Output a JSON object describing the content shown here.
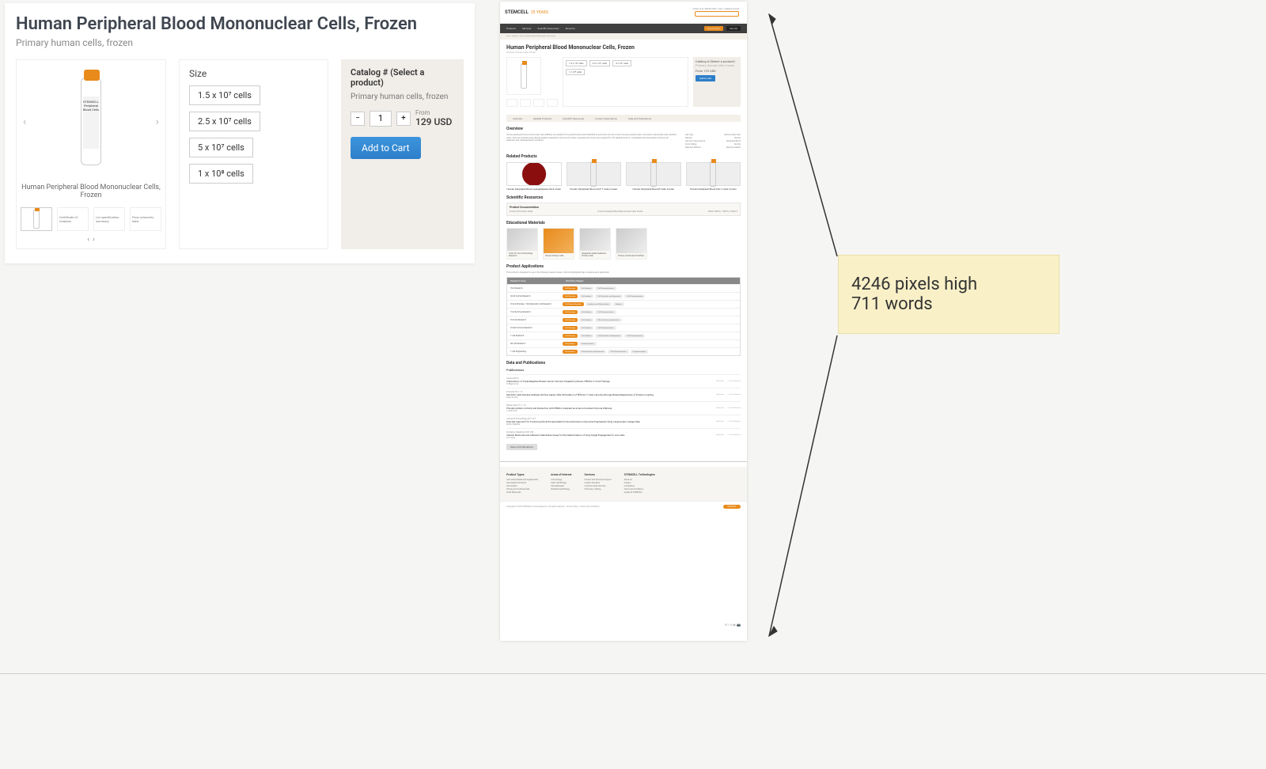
{
  "detail": {
    "title": "Human Peripheral Blood Mononuclear Cells, Frozen",
    "subtitle": "Primary human cells, frozen",
    "caption": "Human Peripheral Blood Mononuclear Cells, Frozen",
    "vial_brand": "STEMCELL",
    "vial_line1": "Peripheral",
    "vial_line2": "Blood Cells",
    "sizes": [
      "1.5 x 10⁷ cells",
      "2.5 x 10⁷ cells",
      "5 x 10⁷ cells",
      "1 x 10⁸ cells"
    ],
    "size_label": "Size",
    "catalog_label": "Catalog # (Select a product)",
    "qty": "1",
    "price_from": "From",
    "price": "129 USD",
    "add_to_cart": "Add to Cart"
  },
  "annotation": {
    "line1": "4246 pixels high",
    "line2": "711 words"
  },
  "fullpage": {
    "logo_main": "STEMCELL",
    "logo_years": "25 YEARS",
    "top_links": "Contact us at 1 800 667 0322 • Log in • Create an account",
    "search_placeholder": "Search for a product or resource",
    "nav": [
      "Products",
      "Services",
      "Scientific Resources",
      "About Us"
    ],
    "nav_right": [
      "Quick Order",
      "Cart (0)"
    ],
    "breadcrumb": "Home › Products › Human Peripheral Blood Mononuclear Cells, Frozen",
    "title": "Human Peripheral Blood Mononuclear Cells, Frozen",
    "subtitle": "Primary human cells, frozen",
    "sizes": [
      "1.5 x 10⁷ cells",
      "2.5 x 10⁷ cells",
      "5 x 10⁷ cells",
      "1 x 10⁸ cells"
    ],
    "catalog": "Catalog # (Select a product)",
    "cart_sub": "Primary human cells, frozen",
    "price": "From 129 USD",
    "add": "Add to Cart",
    "tabs": [
      "Overview",
      "Related Products",
      "Scientific Resources",
      "Product Applications",
      "Data and Publications"
    ],
    "overview_h": "Overview",
    "overview_txt": "Human peripheral blood mononuclear cells (PBMCs) are isolated from peripheral blood and identified as any blood cell with a round nucleus (lymphocytes, monocytes, natural killer cells, dendritic cells). Cells are collected using density gradient separation protocols and viably cryopreserved. Donors are screened for HIV, hepatitis B and C. Compatible with downstream immune cell expansion and characterization workflows.",
    "overview_meta": [
      [
        "Cell Type",
        "Mononuclear Cells"
      ],
      [
        "Species",
        "Human"
      ],
      [
        "Cell and Tissue Source",
        "Peripheral Blood"
      ],
      [
        "Donor Status",
        "Normal"
      ],
      [
        "Selection Method",
        "Density Gradient"
      ]
    ],
    "related_h": "Related Products",
    "related": [
      "Human Peripheral Blood Leukapheresis Pack, Fresh",
      "Human Peripheral Blood CD4⁺ T Cells, Frozen",
      "Human Peripheral Blood B Cells, Frozen",
      "Human Peripheral Blood Pan-T Cells, Frozen"
    ],
    "sci_h": "Scientific Resources",
    "doc_h": "Product Documentation",
    "doc_row_left": "Product Information Sheet",
    "doc_row_mid": "Human Peripheral Blood Mononuclear Cells, Frozen",
    "doc_row_right": "70025, 70025.1, 70025.2, 70025.3",
    "edu_h": "Educational Materials",
    "edu_tiles": [
      "Tools for Your Immunology Research",
      "Human Primary Cells",
      "Frequently Asked Questions: Primary Cells",
      "Primary Cell Product Portfolio"
    ],
    "apps_h": "Product Applications",
    "apps_intro": "This product is designed for use in the following research areas. Click the highlighted tags to explore each application.",
    "apps_cols": [
      "Research Area",
      "Workflow Stages"
    ],
    "apps_rows": [
      {
        "area": "HLA Research",
        "tags": [
          "Cell Sourcing",
          "Cell Isolation",
          "Cell Characterization"
        ]
      },
      {
        "area": "Small Animal Research",
        "tags": [
          "Cell Sourcing",
          "Cell Isolation",
          "Cell Activation and Expansion",
          "Cell Characterization"
        ]
      },
      {
        "area": "Immunotherapy / Hematopoietic Cell Research",
        "tags": [
          "Cell Sample Donation",
          "Isolation and Differentiation",
          "Analysis"
        ]
      },
      {
        "area": "Toxicity/Drug Research",
        "tags": [
          "Cell Sourcing",
          "Cell Isolation",
          "Cell Characterization"
        ]
      },
      {
        "area": "Immune Research",
        "tags": [
          "Cell Sourcing",
          "Cell Isolation",
          "HPs and Immunostimulants"
        ]
      },
      {
        "area": "Innate Immune Research",
        "tags": [
          "Cell Sourcing",
          "Cell Isolation",
          "Cell Characterization"
        ]
      },
      {
        "area": "T Cell Research",
        "tags": [
          "Cell Sourcing",
          "Cell Isolation",
          "Cell Activation and Expansion",
          "Cell Characterization"
        ]
      },
      {
        "area": "NK Cell Research",
        "tags": [
          "Cell Isolation",
          "Characterization"
        ]
      },
      {
        "area": "T Cell Engineering",
        "tags": [
          "Cell Isolation",
          "Cell Activation and Expansion",
          "Cell Characterization",
          "Cryopreservation"
        ]
      }
    ],
    "pubs_h": "Data and Publications",
    "pubs_sub": "Publications",
    "pubs": [
      {
        "src": "Lancet (2019)",
        "title": "Implications of Triple-Negative Breast Cancer Immune-Targeted Cytotoxic PBMCs in T-Cell Therapy",
        "by": "R. Meyer et al."
      },
      {
        "src": "Immunity 30:1–12",
        "title": "Dendritic Cells Express Multiple Surface Genes After Stimulation of Effector T Cells Carrying Strongly Biased Repertoires of Protein-Coupling",
        "by": "Davis B. et al."
      },
      {
        "src": "Nature (April 11) 1–19",
        "title": "Phosphorylation Activity and Interaction with PBMCs Analyzed as a De-Convoluted Immune Pathway",
        "by": "J. Park et al."
      },
      {
        "src": "Journal of Immunology 297:1197",
        "title": "Directed Approach for Producing Novel Encapsulated Immune-Derived Compounds Engineered Using Large-Scale Lineage Data",
        "by": "Smith, Williams."
      },
      {
        "src": "Frontiers in Medicine 7201:234",
        "title": "Cellular Electrode and Adhesion Membrane Assay for the Determination of Drug-Target Engagement in Live Cells",
        "by": "Lin Y et al."
      }
    ],
    "pub_icons": [
      "Abstract",
      "View Publication"
    ],
    "show_all": "Show All Publications",
    "footer": {
      "cols": [
        {
          "h": "Product Types",
          "items": [
            "Cell Culture Media and Supplements",
            "Cell Isolation Products",
            "Instruments",
            "Primary and Cultured Cells",
            "Small Molecules"
          ]
        },
        {
          "h": "Areas of Interest",
          "items": [
            "Immunology",
            "Stem Cell Biology",
            "Hematopoiesis",
            "Epithelial Cell Biology"
          ]
        },
        {
          "h": "Services",
          "items": [
            "Product and Technical Support",
            "Custom Solutions",
            "Contract Assay Services",
            "Proficiency Testing"
          ]
        },
        {
          "h": "STEMCELL Technologies",
          "items": [
            "About Us",
            "Careers",
            "Compliance",
            "Terms and Conditions",
            "Quality at STEMCELL"
          ]
        }
      ],
      "copy": "Copyright © 2018 STEMCELL Technologies Inc. All rights reserved.   •   Privacy Policy   •   Terms and Conditions",
      "chat": "Chat now"
    }
  }
}
